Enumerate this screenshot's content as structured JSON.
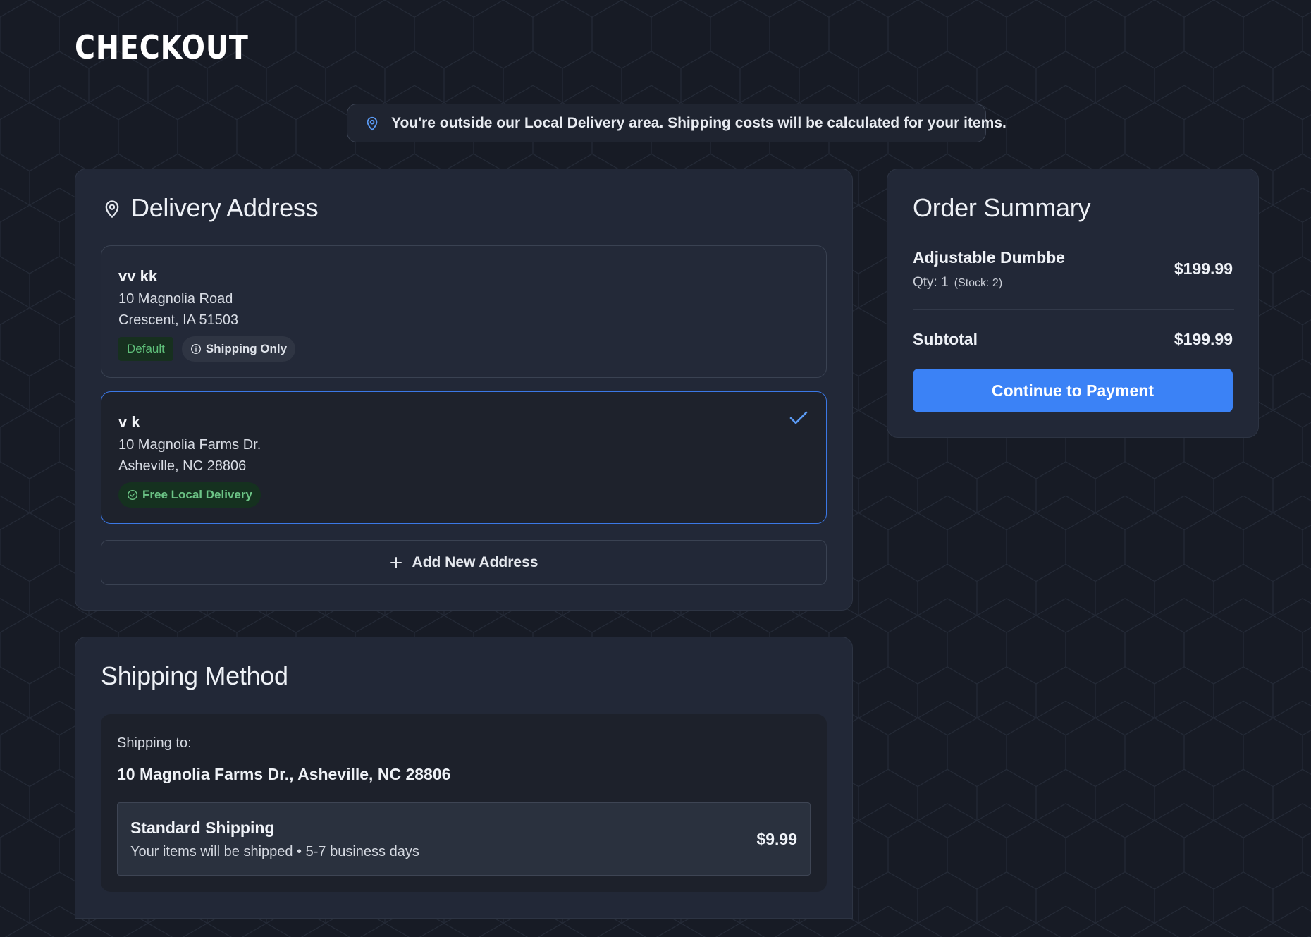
{
  "page": {
    "title": "CHECKOUT"
  },
  "notice": {
    "icon": "map-pin-icon",
    "text": "You're outside our Local Delivery area. Shipping costs will be calculated for your items."
  },
  "delivery": {
    "heading": "Delivery Address",
    "icon": "map-pin-icon",
    "addresses": [
      {
        "name": "vv kk",
        "line1": "10 Magnolia Road",
        "line2": "Crescent, IA 51503",
        "badge_default": "Default",
        "badge_shipping": "Shipping Only",
        "selected": false
      },
      {
        "name": "v k",
        "line1": "10 Magnolia Farms Dr.",
        "line2": "Asheville, NC 28806",
        "badge_local": "Free Local Delivery",
        "selected": true
      }
    ],
    "add_button": "Add New Address"
  },
  "shipping": {
    "heading": "Shipping Method",
    "to_label": "Shipping to:",
    "to_address": "10 Magnolia Farms Dr., Asheville, NC 28806",
    "options": [
      {
        "name": "Standard Shipping",
        "description": "Your items will be shipped • 5-7 business days",
        "price": "$9.99"
      }
    ]
  },
  "summary": {
    "heading": "Order Summary",
    "items": [
      {
        "name": "Adjustable Dumbbe",
        "qty": "Qty: 1",
        "stock": "(Stock: 2)",
        "price": "$199.99"
      }
    ],
    "subtotal_label": "Subtotal",
    "subtotal_value": "$199.99",
    "continue_button": "Continue to Payment"
  },
  "colors": {
    "background": "#171b25",
    "card": "#222837",
    "accent": "#3b82f6",
    "success": "#5fc07a"
  }
}
